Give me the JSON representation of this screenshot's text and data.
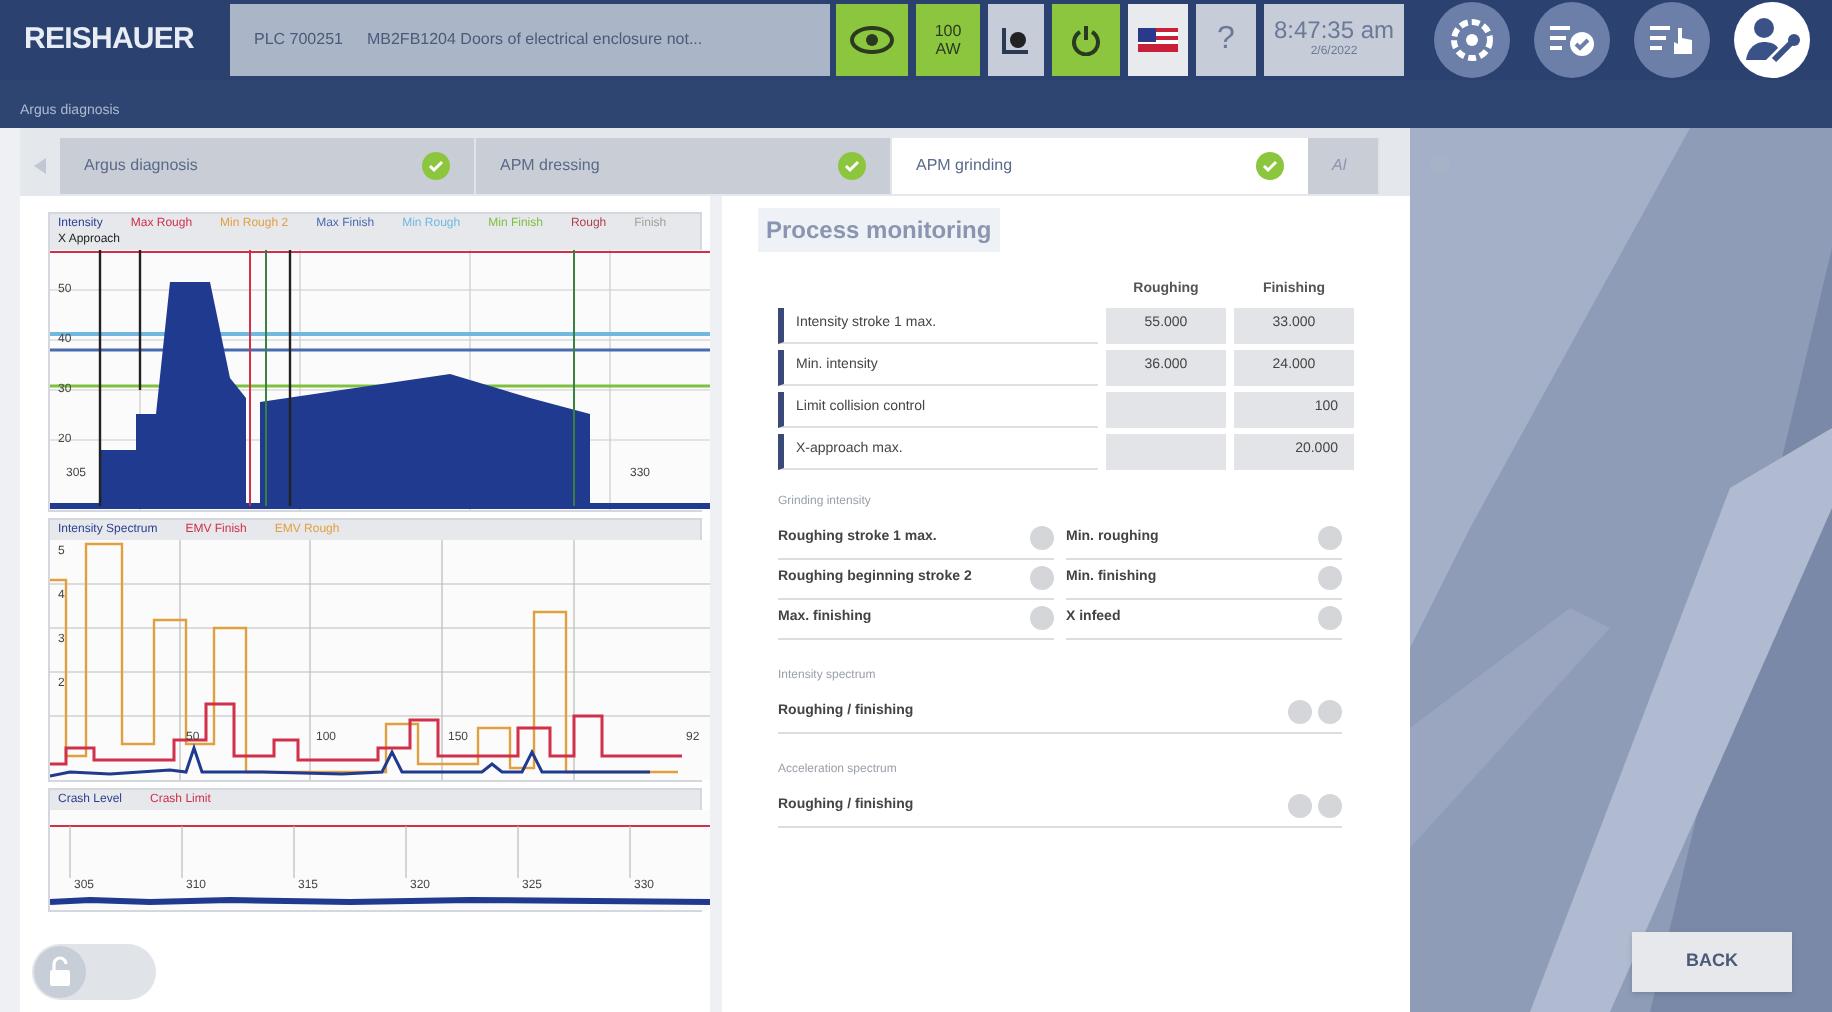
{
  "header": {
    "logo": "REISHAUER",
    "plc": "PLC 700251",
    "message": "MB2FB1204 Doors of electrical enclosure not...",
    "counter": [
      "100",
      "AW"
    ],
    "time": "8:47:35 am",
    "date": "2/6/2022",
    "help": "?",
    "status_buttons": [
      {
        "kind": "eye",
        "on": true
      },
      {
        "kind": "counter",
        "on": true
      },
      {
        "kind": "record",
        "on": false
      },
      {
        "kind": "power",
        "on": true
      },
      {
        "kind": "flag"
      },
      {
        "kind": "help",
        "on": false
      }
    ]
  },
  "breadcrumb": "Argus diagnosis",
  "tabs": [
    {
      "label": "Argus diagnosis",
      "complete": true,
      "selected": false
    },
    {
      "label": "APM dressing",
      "complete": true,
      "selected": false
    },
    {
      "label": "APM grinding",
      "complete": true,
      "selected": true
    },
    {
      "label": "Al",
      "complete": false,
      "selected": false
    }
  ],
  "charts": [
    {
      "legend": [
        {
          "label": "Intensity",
          "color": "#2b3f8f"
        },
        {
          "label": "Max Rough",
          "color": "#d0304a"
        },
        {
          "label": "Min Rough 2",
          "color": "#e0a040"
        },
        {
          "label": "Max Finish",
          "color": "#4a6ab0"
        },
        {
          "label": "Min Rough",
          "color": "#70b8e0"
        },
        {
          "label": "Min Finish",
          "color": "#80c040"
        },
        {
          "label": "Rough",
          "color": "#b04050"
        },
        {
          "label": "Finish",
          "color": "#a0a0a0"
        },
        {
          "label": "X Approach",
          "color": "#222222"
        }
      ],
      "y_labels": [
        "50",
        "40",
        "30",
        "20"
      ],
      "x_labels": [
        "305",
        "330"
      ]
    },
    {
      "legend": [
        {
          "label": "Intensity Spectrum",
          "color": "#2b3f8f"
        },
        {
          "label": "EMV Finish",
          "color": "#d0304a"
        },
        {
          "label": "EMV Rough",
          "color": "#e0a040"
        }
      ],
      "y_labels": [
        "5",
        "4",
        "3",
        "2"
      ],
      "x_labels": [
        "50",
        "100",
        "150",
        "92"
      ]
    },
    {
      "legend": [
        {
          "label": "Crash Level",
          "color": "#2b3f8f"
        },
        {
          "label": "Crash Limit",
          "color": "#d0304a"
        }
      ],
      "x_labels": [
        "305",
        "310",
        "315",
        "320",
        "325",
        "330"
      ]
    }
  ],
  "process_monitoring": {
    "title": "Process monitoring",
    "columns": [
      "Roughing",
      "Finishing"
    ],
    "rows": [
      {
        "label": "Intensity stroke 1 max.",
        "roughing": "55.000",
        "finishing": "33.000"
      },
      {
        "label": "Min. intensity",
        "roughing": "36.000",
        "finishing": "24.000"
      },
      {
        "label": "Limit collision control",
        "finishing": "100"
      },
      {
        "label": "X-approach max.",
        "finishing": "20.000"
      }
    ],
    "grinding_intensity": {
      "title": "Grinding intensity",
      "items": [
        {
          "label": "Roughing stroke 1 max.",
          "active": false
        },
        {
          "label": "Min. roughing",
          "active": false
        },
        {
          "label": "Roughing beginning stroke 2",
          "active": false
        },
        {
          "label": "Min. finishing",
          "active": false
        },
        {
          "label": "Max. finishing",
          "active": false
        },
        {
          "label": "X infeed",
          "active": false
        }
      ]
    },
    "spectra": [
      {
        "title": "Intensity spectrum",
        "label": "Roughing / finishing",
        "indicators": [
          false,
          false
        ]
      },
      {
        "title": "Acceleration spectrum",
        "label": "Roughing / finishing",
        "indicators": [
          false,
          false
        ]
      }
    ]
  },
  "lock_toggle": {
    "on": false
  },
  "back_button": "BACK"
}
